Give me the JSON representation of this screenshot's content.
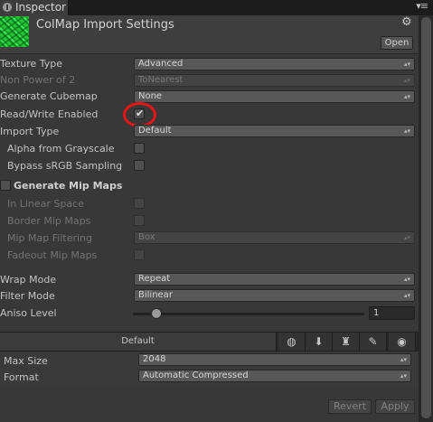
{
  "window": {
    "tab_label": "Inspector",
    "tab_menu": "▾≡"
  },
  "header": {
    "title": "ColMap Import Settings",
    "open_label": "Open"
  },
  "fields": {
    "texture_type": {
      "label": "Texture Type",
      "value": "Advanced"
    },
    "non_power_of_2": {
      "label": "Non Power of 2",
      "value": "ToNearest"
    },
    "generate_cubemap": {
      "label": "Generate Cubemap",
      "value": "None"
    },
    "read_write": {
      "label": "Read/Write Enabled",
      "checked": true
    },
    "import_type": {
      "label": "Import Type",
      "value": "Default"
    },
    "alpha_from_grayscale": {
      "label": "Alpha from Grayscale"
    },
    "bypass_srgb": {
      "label": "Bypass sRGB Sampling"
    },
    "generate_mip_maps": {
      "label": "Generate Mip Maps"
    },
    "in_linear_space": {
      "label": "In Linear Space"
    },
    "border_mip_maps": {
      "label": "Border Mip Maps"
    },
    "mip_map_filtering": {
      "label": "Mip Map Filtering",
      "value": "Box"
    },
    "fadeout_mip_maps": {
      "label": "Fadeout Mip Maps"
    },
    "wrap_mode": {
      "label": "Wrap Mode",
      "value": "Repeat"
    },
    "filter_mode": {
      "label": "Filter Mode",
      "value": "Bilinear"
    },
    "aniso_level": {
      "label": "Aniso Level",
      "value": "1",
      "slider_fraction": 0.1
    }
  },
  "platforms": {
    "default_label": "Default",
    "icons": [
      "globe-icon",
      "download-icon",
      "android-icon",
      "pencil-icon",
      "camera-icon"
    ]
  },
  "platform_settings": {
    "max_size": {
      "label": "Max Size",
      "value": "2048"
    },
    "format": {
      "label": "Format",
      "value": "Automatic Compressed"
    }
  },
  "footer": {
    "revert_label": "Revert",
    "apply_label": "Apply"
  },
  "colors": {
    "highlight": "#e81515",
    "panel": "#383838"
  }
}
